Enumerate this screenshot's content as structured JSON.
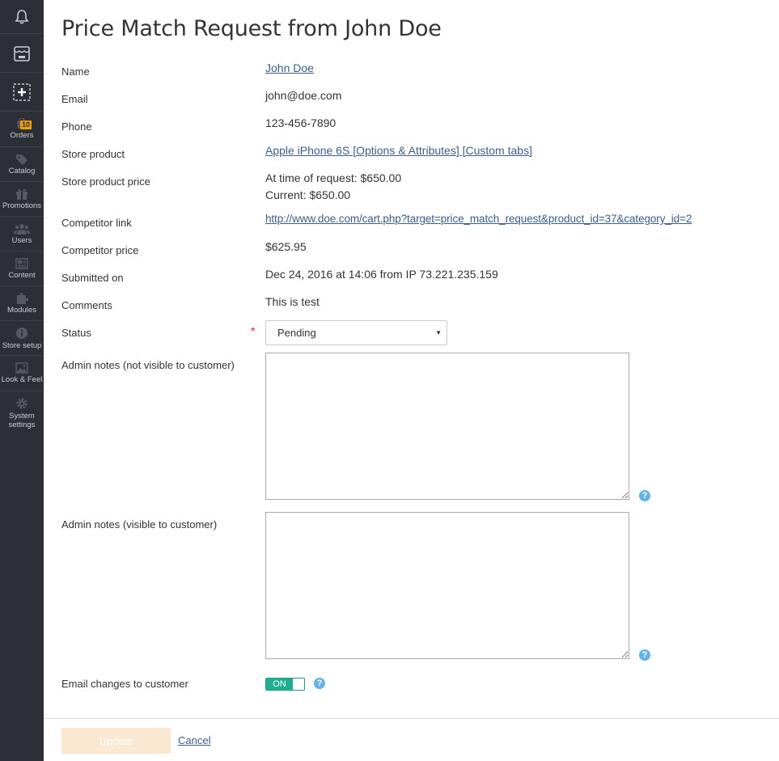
{
  "sidebar": {
    "items": [
      {
        "icon": "bell-icon",
        "label": ""
      },
      {
        "icon": "store-icon",
        "label": ""
      },
      {
        "icon": "add-icon",
        "label": ""
      },
      {
        "icon": "orders-icon",
        "label": "Orders",
        "badge": "10"
      },
      {
        "icon": "tag-icon",
        "label": "Catalog"
      },
      {
        "icon": "gift-icon",
        "label": "Promotions"
      },
      {
        "icon": "users-icon",
        "label": "Users"
      },
      {
        "icon": "content-icon",
        "label": "Content"
      },
      {
        "icon": "puzzle-icon",
        "label": "Modules"
      },
      {
        "icon": "info-icon",
        "label": "Store setup"
      },
      {
        "icon": "image-icon",
        "label": "Look & Feel"
      },
      {
        "icon": "gear-icon",
        "label": "System\nsettings"
      }
    ]
  },
  "page": {
    "title": "Price Match Request from John Doe"
  },
  "fields": {
    "name_label": "Name",
    "name_value": "John Doe",
    "email_label": "Email",
    "email_value": "john@doe.com",
    "phone_label": "Phone",
    "phone_value": "123-456-7890",
    "product_label": "Store product",
    "product_value": "Apple iPhone 6S [Options & Attributes] [Custom tabs]",
    "price_label": "Store product price",
    "price_request": "At time of request: $650.00",
    "price_current": "Current: $650.00",
    "competitor_link_label": "Competitor link",
    "competitor_link_value": "http://www.doe.com/cart.php?target=price_match_request&product_id=37&category_id=2",
    "competitor_price_label": "Competitor price",
    "competitor_price_value": "$625.95",
    "submitted_label": "Submitted on",
    "submitted_value": "Dec 24, 2016 at 14:06 from IP 73.221.235.159",
    "comments_label": "Comments",
    "comments_value": "This is test",
    "status_label": "Status",
    "status_required": "*",
    "status_value": "Pending",
    "admin_notes_private_label": "Admin notes (not visible to customer)",
    "admin_notes_private_value": "",
    "admin_notes_public_label": "Admin notes (visible to customer)",
    "admin_notes_public_value": "",
    "email_changes_label": "Email changes to customer",
    "email_changes_toggle": "ON"
  },
  "actions": {
    "update_label": "Update",
    "cancel_label": "Cancel"
  },
  "colors": {
    "sidebar_bg": "#2c2f36",
    "link": "#3d5d8a",
    "toggle_on": "#1fae91",
    "help": "#62b3e8",
    "badge": "#f29f05",
    "required": "#d9262e"
  }
}
